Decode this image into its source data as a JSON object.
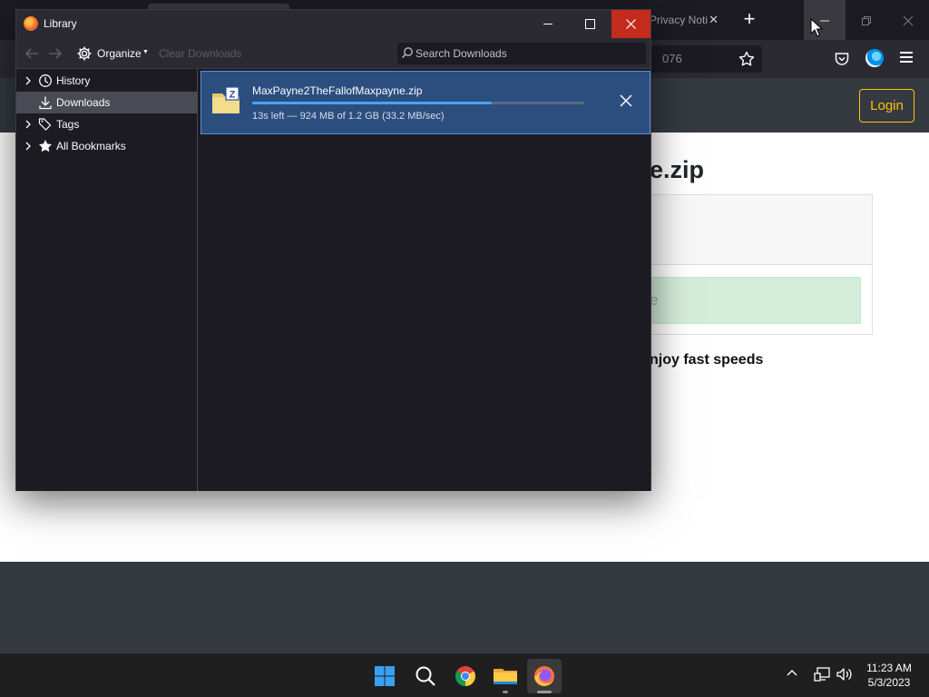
{
  "background_browser": {
    "tab_privacy_label": "Privacy Noti",
    "url_fragment": "076",
    "site": {
      "login_label": "Login",
      "file_title_fragment": "e.zip",
      "download_button_fragment": "e",
      "speed_text_fragment": "njoy fast speeds"
    }
  },
  "library": {
    "title": "Library",
    "toolbar": {
      "organize_label": "Organize",
      "clear_downloads_label": "Clear Downloads",
      "search_placeholder": "Search Downloads"
    },
    "sidebar": {
      "items": [
        {
          "label": "History",
          "icon": "clock-icon",
          "expandable": true,
          "selected": false
        },
        {
          "label": "Downloads",
          "icon": "download-arrow-icon",
          "expandable": false,
          "selected": true
        },
        {
          "label": "Tags",
          "icon": "tags-icon",
          "expandable": true,
          "selected": false
        },
        {
          "label": "All Bookmarks",
          "icon": "star-icon",
          "expandable": true,
          "selected": false
        }
      ]
    },
    "downloads": [
      {
        "filename": "MaxPayne2TheFallofMaxpayne.zip",
        "status": "13s left — 924 MB of 1.2 GB (33.2 MB/sec)",
        "progress_fraction": 0.72
      }
    ]
  },
  "taskbar": {
    "apps": [
      "windows-start-icon",
      "search-icon",
      "chrome-icon",
      "file-explorer-icon",
      "firefox-icon"
    ],
    "time": "11:23 AM",
    "date": "5/3/2023"
  },
  "colors": {
    "accent_blue": "#4aa3ff",
    "selection_blue": "#2b4e7f",
    "close_red": "#c42b1c",
    "login_yellow": "#ffc107"
  }
}
